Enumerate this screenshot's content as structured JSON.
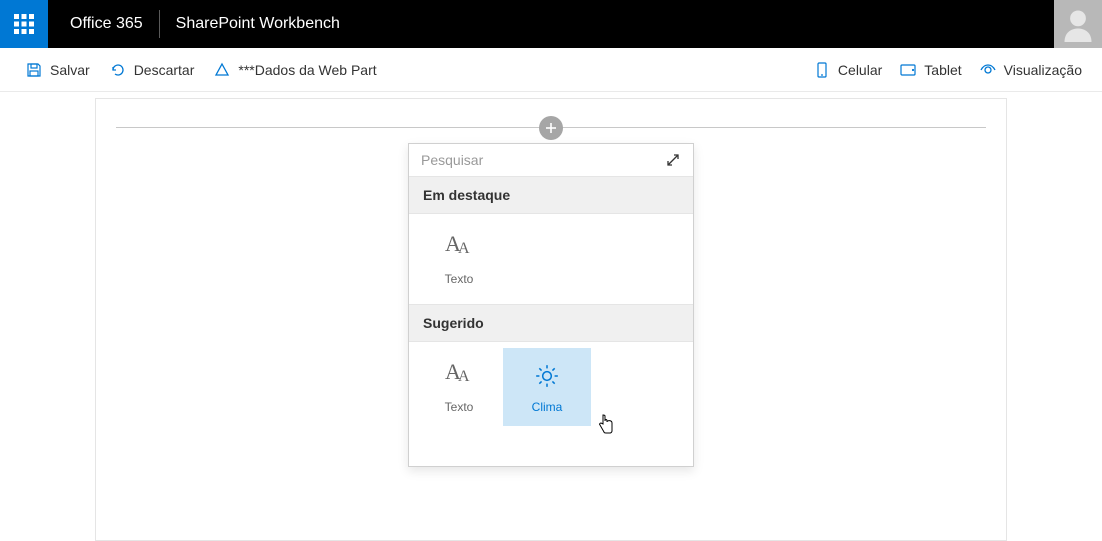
{
  "suite": {
    "brand": "Office 365",
    "appTitle": "SharePoint Workbench"
  },
  "commandBar": {
    "save": "Salvar",
    "discard": "Descartar",
    "webPartData": "***Dados da Web Part",
    "mobile": "Celular",
    "tablet": "Tablet",
    "preview": "Visualização"
  },
  "toolbox": {
    "searchPlaceholder": "Pesquisar",
    "featuredHeader": "Em destaque",
    "suggestedHeader": "Sugerido",
    "items": {
      "text": "Texto",
      "weather": "Clima"
    }
  }
}
